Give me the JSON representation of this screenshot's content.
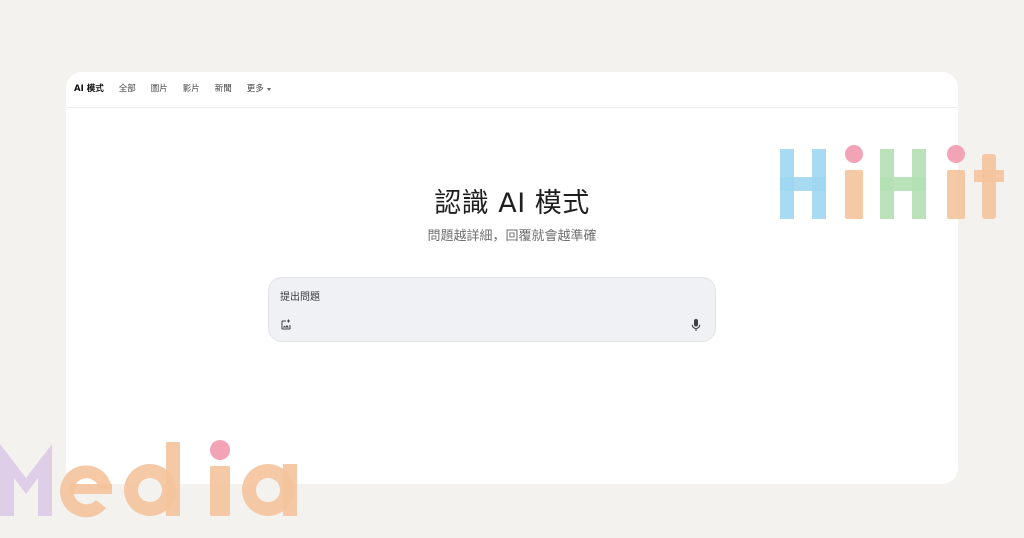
{
  "nav": {
    "tabs": [
      {
        "label": "AI 模式",
        "active": true
      },
      {
        "label": "全部"
      },
      {
        "label": "圖片"
      },
      {
        "label": "影片"
      },
      {
        "label": "新聞"
      },
      {
        "label": "更多"
      }
    ]
  },
  "main": {
    "title": "認識 AI 模式",
    "subtitle": "問題越詳細，回覆就會越準確"
  },
  "search": {
    "placeholder": "提出問題",
    "value": ""
  },
  "icons": {
    "image_upload": "add-image-icon",
    "mic": "microphone-icon",
    "more_caret": "caret-down-icon"
  },
  "watermarks": {
    "top_right": "HiHit",
    "bottom_left": "Media"
  },
  "colors": {
    "page_bg": "#f4f2ee",
    "card_bg": "#ffffff",
    "search_bg": "#f0f1f5",
    "wm_blue": "#9fd6f0",
    "wm_orange": "#f4c39b",
    "wm_green": "#b4e0b2",
    "wm_pink": "#f2a4b6",
    "wm_purple": "#dccbe6"
  }
}
